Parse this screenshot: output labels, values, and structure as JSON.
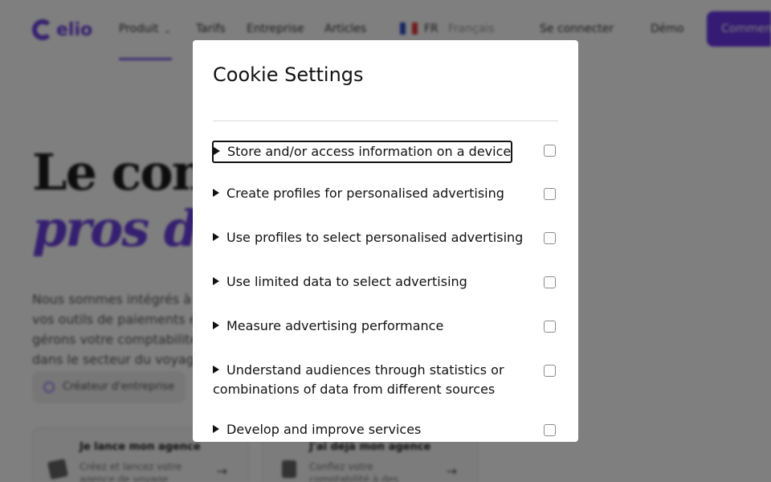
{
  "background": {
    "logo_text": "elio",
    "nav": {
      "product": "Produit",
      "pricing": "Tarifs",
      "company": "Entreprise",
      "articles": "Articles",
      "language_code": "FR",
      "language_name": "Français",
      "get_started": "Se connecter",
      "demo": "Démo",
      "connect": "Commencer"
    },
    "hero": {
      "line1": "Le comptable des",
      "line2": "pros du voyage",
      "paragraph": "Nous sommes intégrés à vos outils de paiements et gérons votre comptabilité dans le secteur du voyage."
    },
    "chip": "Créateur d'entreprise",
    "cards": [
      {
        "title": "Je lance mon agence",
        "body": "Créez et lancez votre agence de voyage facilement"
      },
      {
        "title": "J'ai déjà mon agence",
        "body": "Confiez votre comptabilité à des experts dédiés"
      }
    ]
  },
  "modal": {
    "title": "Cookie Settings",
    "purposes": [
      {
        "label": "Store and/or access information on a device",
        "checked": false,
        "focused": true
      },
      {
        "label": "Create profiles for personalised advertising",
        "checked": false
      },
      {
        "label": "Use profiles to select personalised advertising",
        "checked": false
      },
      {
        "label": "Use limited data to select advertising",
        "checked": false
      },
      {
        "label": "Measure advertising performance",
        "checked": false
      },
      {
        "label": "Understand audiences through statistics or combinations of data from different sources",
        "checked": false
      },
      {
        "label": "Develop and improve services",
        "checked": false
      }
    ]
  },
  "colors": {
    "brand_purple": "#6a3ee0",
    "overlay": "rgba(0,0,0,0.5)"
  }
}
